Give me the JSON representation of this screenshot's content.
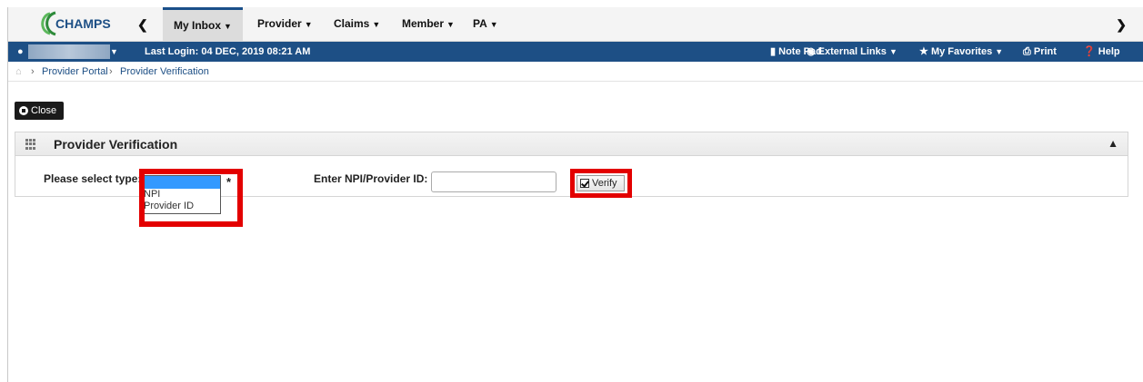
{
  "nav": {
    "logo_text": "CHAMPS",
    "items": [
      {
        "label": "My Inbox"
      },
      {
        "label": "Provider"
      },
      {
        "label": "Claims"
      },
      {
        "label": "Member"
      },
      {
        "label": "PA"
      }
    ]
  },
  "bluebar": {
    "last_login": "Last Login: 04 DEC, 2019 08:21 AM",
    "note_pad": "Note Pad",
    "external_links": "External Links",
    "my_favorites": "My Favorites",
    "print": "Print",
    "help": "Help"
  },
  "breadcrumb": {
    "items": [
      "Provider Portal",
      "Provider Verification"
    ]
  },
  "close_label": "Close",
  "panel": {
    "title": "Provider Verification",
    "select_label": "Please select type:",
    "type_options": [
      "",
      "NPI",
      "Provider ID"
    ],
    "id_label": "Enter NPI/Provider ID:",
    "id_value": "",
    "verify_label": "Verify"
  },
  "colors": {
    "nav_blue": "#1d4f85",
    "highlight_red": "#e30000",
    "selection_blue": "#3399ff"
  }
}
